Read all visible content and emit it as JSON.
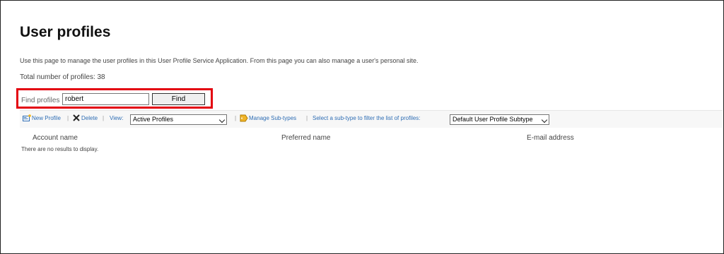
{
  "page": {
    "title": "User profiles",
    "description": "Use this page to manage the user profiles in this User Profile Service Application. From this page you can also manage a user's personal site.",
    "total_label": "Total number of profiles: 38"
  },
  "find": {
    "label": "Find profiles",
    "value": "robert",
    "button": "Find"
  },
  "toolbar": {
    "new_profile": "New Profile",
    "delete": "Delete",
    "view_label": "View:",
    "view_value": "Active Profiles",
    "separator": "|",
    "manage_subtypes": "Manage Sub-types",
    "subtype_prompt": "Select a sub-type to filter the list of profiles:",
    "subtype_value": "Default User Profile Subtype",
    "icons": [
      "new-profile-icon",
      "delete-x-icon",
      "manage-subtypes-icon",
      "dropdown-chevron-icon"
    ]
  },
  "table": {
    "columns": [
      "Account name",
      "Preferred name",
      "E-mail address"
    ],
    "empty_message": "There are no results to display."
  },
  "colors": {
    "highlight_border": "#e3000f",
    "link": "#2e6db4",
    "toolbar_bg": "#f7f7f7"
  }
}
